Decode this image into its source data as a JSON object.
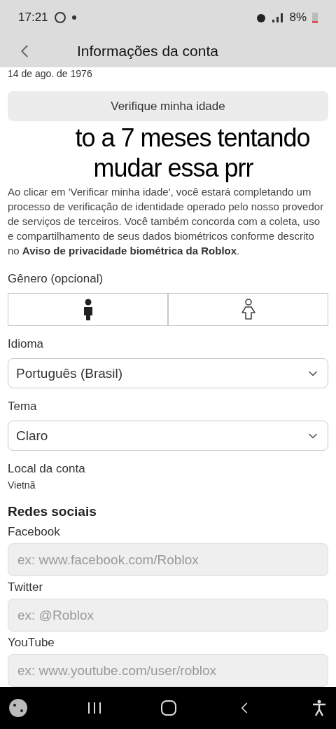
{
  "status_bar": {
    "time": "17:21",
    "battery": "8%"
  },
  "header": {
    "title": "Informações da conta"
  },
  "birthdate": "14 de ago. de 1976",
  "verify_button": "Verifique minha idade",
  "verify_note": "Ao clicar em 'Verificar minha idade', você estará completando um processo de verificação de identidade operado pelo nosso provedor de serviços de terceiros. Você também concorda com a coleta, uso e compartilhamento de seus dados biométricos conforme descrito no **Aviso de privacidade biométrica da Roblox**.",
  "gender": {
    "label": "Gênero (opcional)",
    "options": [
      {
        "kind": "male",
        "selected": false
      },
      {
        "kind": "female",
        "selected": false
      }
    ]
  },
  "language": {
    "label": "Idioma",
    "value": "Português (Brasil)"
  },
  "theme": {
    "label": "Tema",
    "value": "Claro"
  },
  "location": {
    "label": "Local da conta",
    "value": "Vietnã"
  },
  "social": {
    "title": "Redes sociais",
    "fields": [
      {
        "label": "Facebook",
        "placeholder": "ex: www.facebook.com/Roblox"
      },
      {
        "label": "Twitter",
        "placeholder": "ex: @Roblox"
      },
      {
        "label": "YouTube",
        "placeholder": "ex: www.youtube.com/user/roblox"
      }
    ]
  },
  "caption": [
    "to a 7 meses tentando",
    "mudar essa prr"
  ]
}
